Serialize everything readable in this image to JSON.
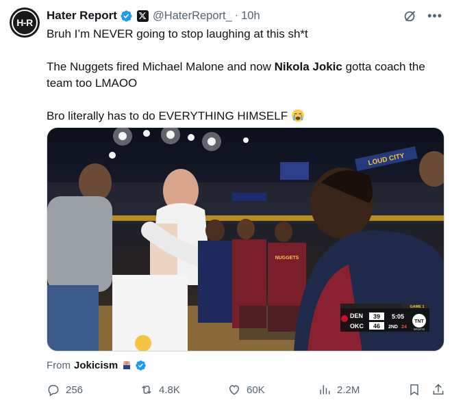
{
  "author": {
    "name": "Hater Report",
    "handle": "@HaterReport_",
    "time": "10h",
    "avatar_text": "H-R"
  },
  "tweet": {
    "line1": "Bruh I’m NEVER going to stop laughing at this sh*t",
    "line2_a": "The Nuggets fired Michael Malone and now ",
    "line2_bold": "Nikola Jokic",
    "line2_b": " gotta coach the team too LMAOO",
    "line3": "Bro literally has to do EVERYTHING HIMSELF",
    "emoji": "crying-face"
  },
  "media": {
    "scorebug": {
      "team1": "DEN",
      "score1": "39",
      "team2": "OKC",
      "score2": "46",
      "clock": "5:05",
      "period": "2ND",
      "shot": "24",
      "game": "GAME 1",
      "network": "TNT",
      "network_sub": "SPORTS"
    },
    "arena_sign": "LOUD CITY",
    "jersey_text": "NUGGETS"
  },
  "source": {
    "from_label": "From",
    "name": "Jokicism"
  },
  "actions": {
    "replies": "256",
    "reposts": "4.8K",
    "likes": "60K",
    "views": "2.2M"
  },
  "colors": {
    "verified": "#1d9bf0",
    "text": "#0f1419",
    "muted": "#536471"
  }
}
